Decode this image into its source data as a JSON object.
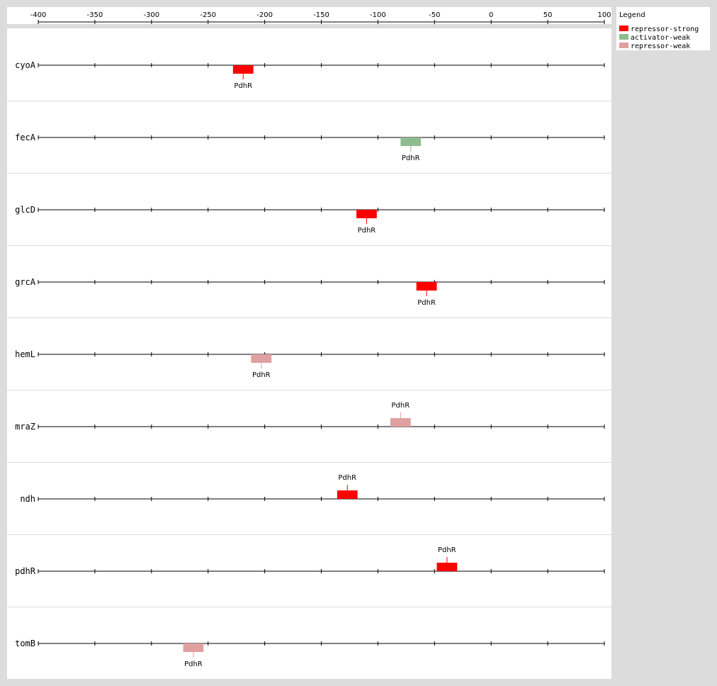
{
  "chart_data": {
    "type": "diagram",
    "x_axis": {
      "min": -400,
      "max": 100,
      "ticks": [
        -400,
        -350,
        -300,
        -250,
        -200,
        -150,
        -100,
        -50,
        0,
        50,
        100
      ],
      "tick_labels": [
        "-400",
        "-350",
        "-300",
        "-250",
        "-200",
        "-150",
        "-100",
        "-50",
        "0",
        "50",
        "100"
      ]
    },
    "legend": {
      "title": "Legend",
      "placement": "top-right",
      "items": [
        {
          "label": "repressor-strong",
          "color": "#ff0000"
        },
        {
          "label": "activator-weak",
          "color": "#8fbc8f"
        },
        {
          "label": "repressor-weak",
          "color": "#e0a0a0"
        }
      ]
    },
    "genes": [
      {
        "name": "cyoA",
        "sites": [
          {
            "tf": "PdhR",
            "start": -228,
            "end": -210,
            "type": "repressor-strong",
            "strand": "below"
          }
        ]
      },
      {
        "name": "fecA",
        "sites": [
          {
            "tf": "PdhR",
            "start": -80,
            "end": -62,
            "type": "activator-weak",
            "strand": "below"
          }
        ]
      },
      {
        "name": "glcD",
        "sites": [
          {
            "tf": "PdhR",
            "start": -119,
            "end": -101,
            "type": "repressor-strong",
            "strand": "below"
          }
        ]
      },
      {
        "name": "grcA",
        "sites": [
          {
            "tf": "PdhR",
            "start": -66,
            "end": -48,
            "type": "repressor-strong",
            "strand": "below"
          }
        ]
      },
      {
        "name": "hemL",
        "sites": [
          {
            "tf": "PdhR",
            "start": -212,
            "end": -194,
            "type": "repressor-weak",
            "strand": "below"
          }
        ]
      },
      {
        "name": "mraZ",
        "sites": [
          {
            "tf": "PdhR",
            "start": -89,
            "end": -71,
            "type": "repressor-weak",
            "strand": "above"
          }
        ]
      },
      {
        "name": "ndh",
        "sites": [
          {
            "tf": "PdhR",
            "start": -136,
            "end": -118,
            "type": "repressor-strong",
            "strand": "above"
          }
        ]
      },
      {
        "name": "pdhR",
        "sites": [
          {
            "tf": "PdhR",
            "start": -48,
            "end": -30,
            "type": "repressor-strong",
            "strand": "above"
          }
        ]
      },
      {
        "name": "tomB",
        "sites": [
          {
            "tf": "PdhR",
            "start": -272,
            "end": -254,
            "type": "repressor-weak",
            "strand": "below"
          }
        ]
      }
    ]
  }
}
